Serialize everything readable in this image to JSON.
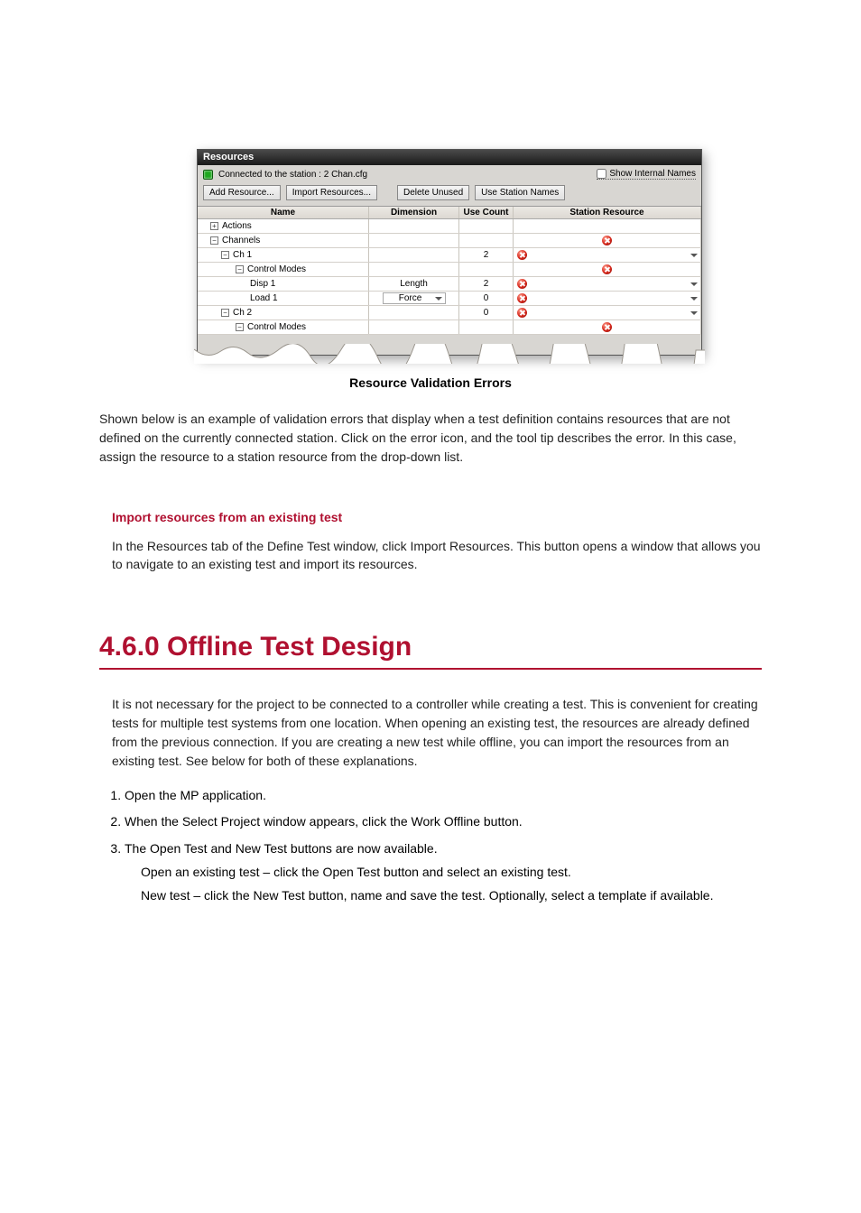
{
  "window": {
    "title": "Resources",
    "status_text": "Connected to the station : 2 Chan.cfg",
    "show_internal_label": "Show Internal Names",
    "buttons": {
      "add": "Add Resource...",
      "import": "Import Resources...",
      "delete_unused": "Delete Unused",
      "use_station": "Use Station Names"
    },
    "columns": {
      "name": "Name",
      "dimension": "Dimension",
      "use_count": "Use Count",
      "station_resource": "Station Resource"
    },
    "rows": {
      "actions": "Actions",
      "channels": "Channels",
      "ch1": "Ch 1",
      "ch1_use": "2",
      "control_modes": "Control Modes",
      "disp1": "Disp 1",
      "disp1_dim": "Length",
      "disp1_use": "2",
      "load1": "Load 1",
      "load1_dim": "Force",
      "load1_use": "0",
      "ch2": "Ch 2",
      "ch2_use": "0",
      "control_modes2": "Control Modes"
    }
  },
  "caption": "Resource Validation Errors",
  "body1": "Shown below is an example of validation errors that display when a test definition contains resources that are not defined on the currently connected station. Click on the error icon, and the tool tip describes the error. In this case, assign the resource to a station resource from the drop-down list.",
  "link_heading": "Import resources from an existing test",
  "para1": "In the Resources tab of the Define Test window, click Import Resources. This button opens a window that allows you to navigate to an existing test and import its resources.",
  "section_title": "4.6.0 Offline Test Design",
  "section_body": "It is not necessary for the project to be connected to a controller while creating a test. This is convenient for creating tests for multiple test systems from one location. When opening an existing test, the resources are already defined from the previous connection. If you are creating a new test while offline, you can import the resources from an existing test. See below for both of these explanations.",
  "steps": {
    "s1": "Open the MP application.",
    "s2": "When the Select Project window appears, click the Work Offline button.",
    "s3": "The Open Test and New Test buttons are now available.",
    "s3a": "Open an existing test – click the Open Test button and select an existing test.",
    "s3b": "New test – click the New Test button, name and save the test. Optionally, select a template if available."
  }
}
